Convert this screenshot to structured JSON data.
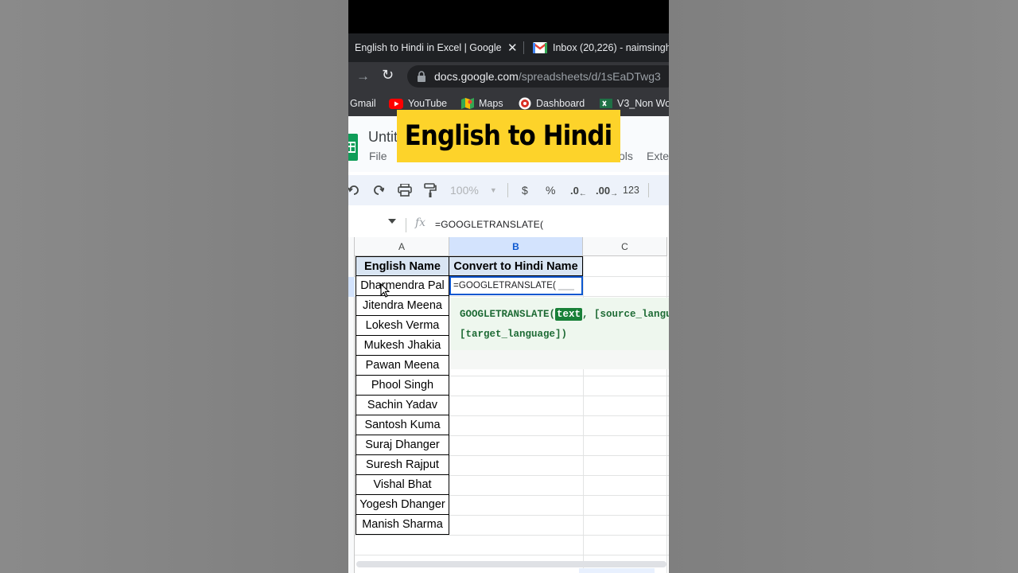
{
  "browser": {
    "tabs": [
      {
        "title": "English to Hindi in Excel | Google Sheets",
        "active": true,
        "close": "✕"
      },
      {
        "title": "Inbox (20,226) - naimsingh",
        "active": false
      }
    ],
    "url_host": "docs.google.com",
    "url_path": "/spreadsheets/d/1sEaDTwg3",
    "bookmarks": [
      "Gmail",
      "YouTube",
      "Maps",
      "Dashboard",
      "V3_Non Wo"
    ]
  },
  "sheets": {
    "doc_title": "Untit",
    "menu": {
      "file": "File",
      "tools": "ols",
      "extensions": "Exte"
    },
    "toolbar": {
      "zoom": "100%",
      "currency": "$",
      "percent": "%",
      "decrease_decimal": ".0",
      "increase_decimal": ".00",
      "number_format": "123"
    },
    "formula_bar": {
      "fx": "fx",
      "formula": "=GOOGLETRANSLATE("
    },
    "columns": [
      "A",
      "B",
      "C"
    ],
    "headers": {
      "a": "English Name",
      "b": "Convert to Hindi Name"
    },
    "names": [
      "Dharmendra Pal",
      "Jitendra Meena",
      "Lokesh Verma",
      "Mukesh Jhakia",
      "Pawan Meena",
      "Phool Singh",
      "Sachin Yadav",
      "Santosh Kuma",
      "Suraj Dhanger",
      "Suresh Rajput",
      "Vishal Bhat",
      "Yogesh Dhanger",
      "Manish Sharma"
    ],
    "active_cell_text": "=GOOGLETRANSLATE(",
    "suggestion": {
      "fn": "GOOGLETRANSLATE(",
      "arg1": "text",
      "rest1": ", [source_langua",
      "line2": "[target_language])"
    }
  },
  "overlay": {
    "banner": "English to Hindi"
  },
  "colors": {
    "banner": "#fdd32a",
    "selected_header": "#d3e3fd",
    "table_header_fill": "#d9e5f3",
    "active_border": "#0b57d0",
    "suggestion_green": "#188038"
  }
}
